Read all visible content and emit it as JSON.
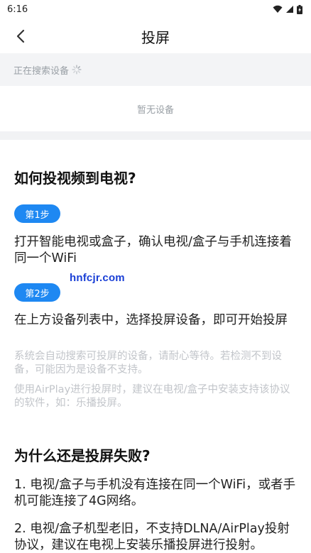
{
  "status_bar": {
    "time": "6:16"
  },
  "nav": {
    "title": "投屏"
  },
  "search": {
    "label": "正在搜索设备"
  },
  "devices": {
    "empty_text": "暂无设备"
  },
  "guide": {
    "title": "如何投视频到电视?",
    "steps": [
      {
        "badge": "第1步",
        "text": "打开智能电视或盒子，确认电视/盒子与手机连接着同一个WiFi"
      },
      {
        "badge": "第2步",
        "text": "在上方设备列表中，选择投屏设备，即可开始投屏"
      }
    ],
    "hints": [
      "系统会自动搜索可投屏的设备，请耐心等待。若检测不到设备，可能因为是设备不支持。",
      "使用AirPlay进行投屏时，建议在电视/盒子中安装支持该协议的软件，如：乐播投屏。"
    ]
  },
  "failure": {
    "title": "为什么还是投屏失败?",
    "items": [
      "1. 电视/盒子与手机没有连接在同一个WiFi，或者手机可能连接了4G网络。",
      "2. 电视/盒子机型老旧，不支持DLNA/AirPlay投射协议，建议在电视上安装乐播投屏进行投射。"
    ]
  },
  "watermark": "hnfcjr.com",
  "colors": {
    "accent": "#1e88f2",
    "hint": "#c2c5ca",
    "section_bg": "#f3f4f6"
  }
}
